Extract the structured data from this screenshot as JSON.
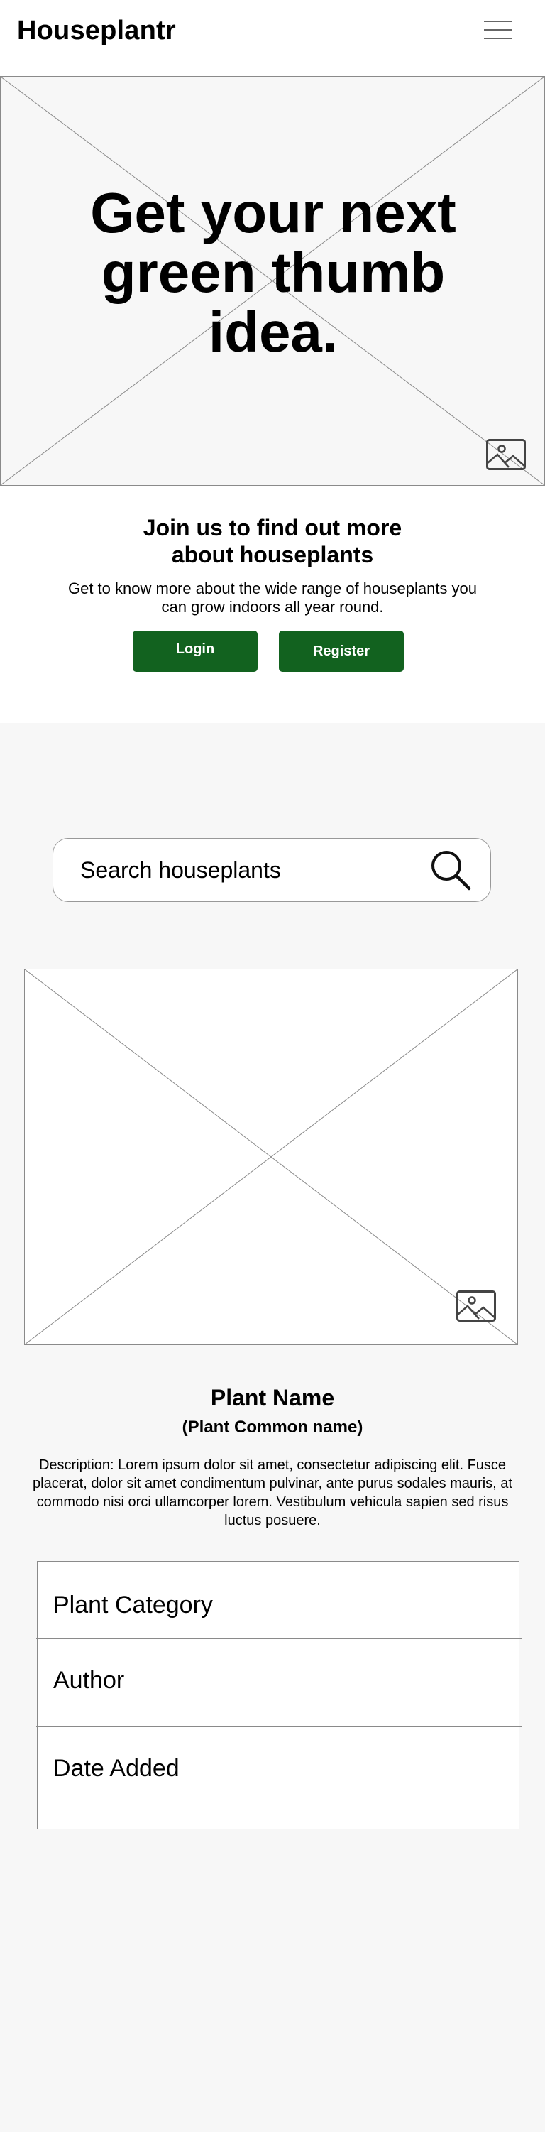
{
  "header": {
    "brand": "Houseplantr",
    "menu_icon": "hamburger-menu-icon"
  },
  "hero": {
    "title": "Get your next green thumb idea.",
    "image_icon": "image-placeholder-icon"
  },
  "join": {
    "title": "Join us to find out more about houseplants",
    "text": "Get to know more about the wide range of houseplants you can grow indoors all year round.",
    "login_label": "Login",
    "register_label": "Register",
    "button_color": "#12621f"
  },
  "search": {
    "placeholder": "Search houseplants",
    "icon": "search-icon"
  },
  "plant": {
    "image_icon": "image-placeholder-icon",
    "name": "Plant Name",
    "common_name": "(Plant Common name)",
    "description": "Description: Lorem ipsum dolor sit amet, consectetur adipiscing elit. Fusce placerat, dolor sit amet condimentum pulvinar, ante purus sodales mauris, at commodo nisi orci ullamcorper lorem. Vestibulum vehicula sapien sed risus luctus posuere.",
    "fields": [
      "Plant Category",
      "Author",
      "Date Added"
    ]
  }
}
